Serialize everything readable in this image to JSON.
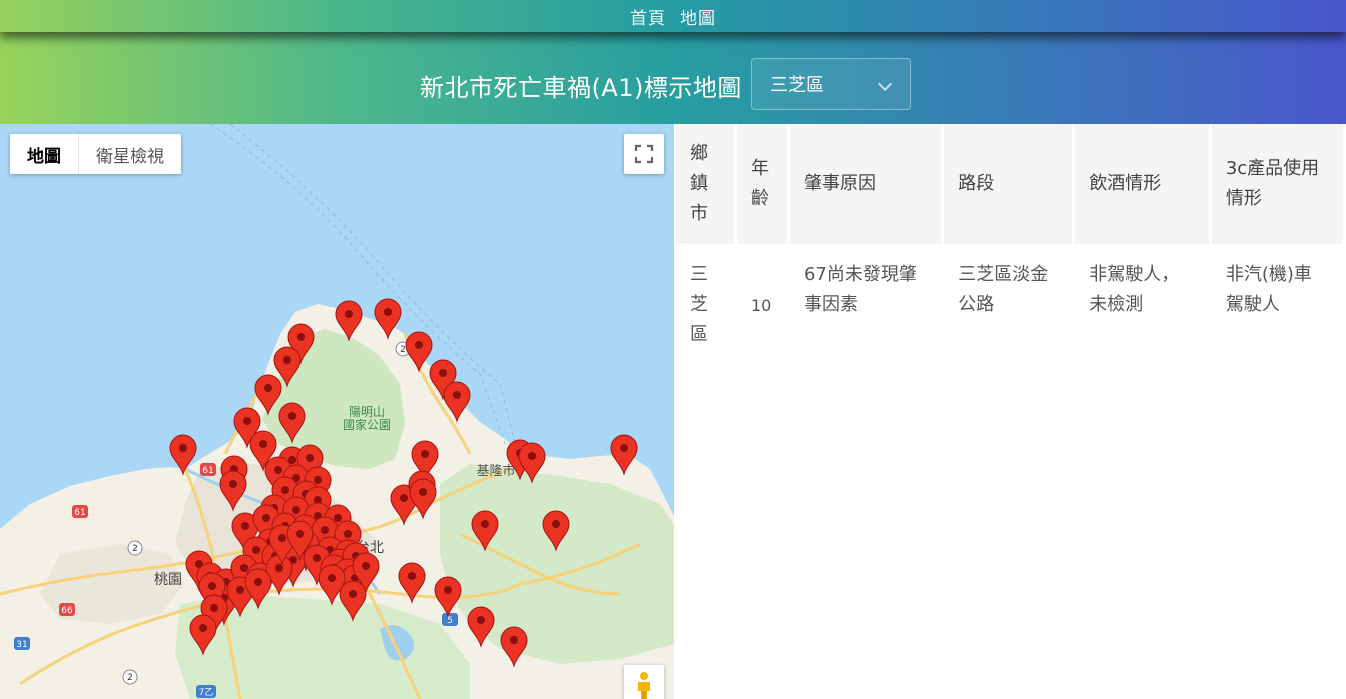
{
  "nav": {
    "home": "首頁",
    "map": "地圖"
  },
  "header": {
    "title": "新北市死亡車禍(A1)標示地圖",
    "district_selected": "三芝區"
  },
  "map": {
    "type_map": "地圖",
    "type_satellite": "衛星檢視",
    "labels": {
      "park_line1": "陽明山",
      "park_line2": "國家公園",
      "keelung": "基隆市",
      "taipei": "台北",
      "taoyuan": "桃園"
    },
    "road_shields": [
      "61",
      "61",
      "2",
      "66",
      "31",
      "7乙",
      "2",
      "5",
      "2"
    ],
    "marker_color": "#ea3323"
  },
  "table": {
    "headers": [
      "鄉鎮市",
      "年齡",
      "肇事原因",
      "路段",
      "飲酒情形",
      "3c產品使用情形"
    ],
    "rows": [
      [
        "三芝區",
        "10",
        "67尚未發現肇事因素",
        "三芝區淡金公路",
        "非駕駛人，未檢測",
        "非汽(機)車駕駛人"
      ]
    ]
  }
}
